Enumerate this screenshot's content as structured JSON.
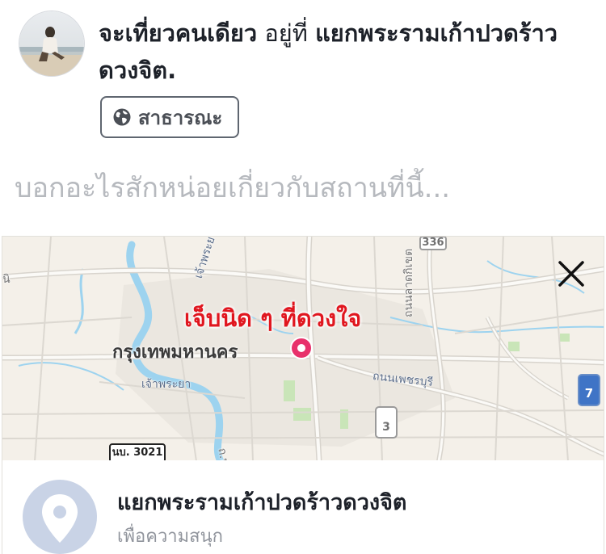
{
  "post_header": {
    "status_prefix": "จะเที่ยวคนเดียว",
    "status_at": "อยู่ที่",
    "place": "แยกพระรามเก้าปวดร้าวดวงจิต."
  },
  "privacy": {
    "label": "สาธารณะ",
    "icon": "globe-icon"
  },
  "composer": {
    "placeholder": "บอกอะไรสักหน่อยเกี่ยวกับสถานที่นี้..."
  },
  "map": {
    "pin_label": "เจ็บนิด ๆ ที่ดวงใจ",
    "city_label": "กรุงเทพมหานคร",
    "street_labels": {
      "river_north": "เจ้าพระยา",
      "river_south": "เจ้าพระยา",
      "road_east": "ถนนเพชรบุรี",
      "road_vertical": "ถนนลาดกิเขต",
      "edge_left": "นิ",
      "bottom_road": "ถ.ทุ"
    },
    "route_badges": {
      "top": "336",
      "right": "7",
      "center": "3",
      "bottom_left": "นบ. 3021"
    },
    "close_icon": "close-icon",
    "marker_color": "#e8316b"
  },
  "place_card": {
    "name": "แยกพระรามเก้าปวดร้าวดวงจิต",
    "category": "เพื่อความสนุก",
    "icon": "map-pin-icon"
  }
}
